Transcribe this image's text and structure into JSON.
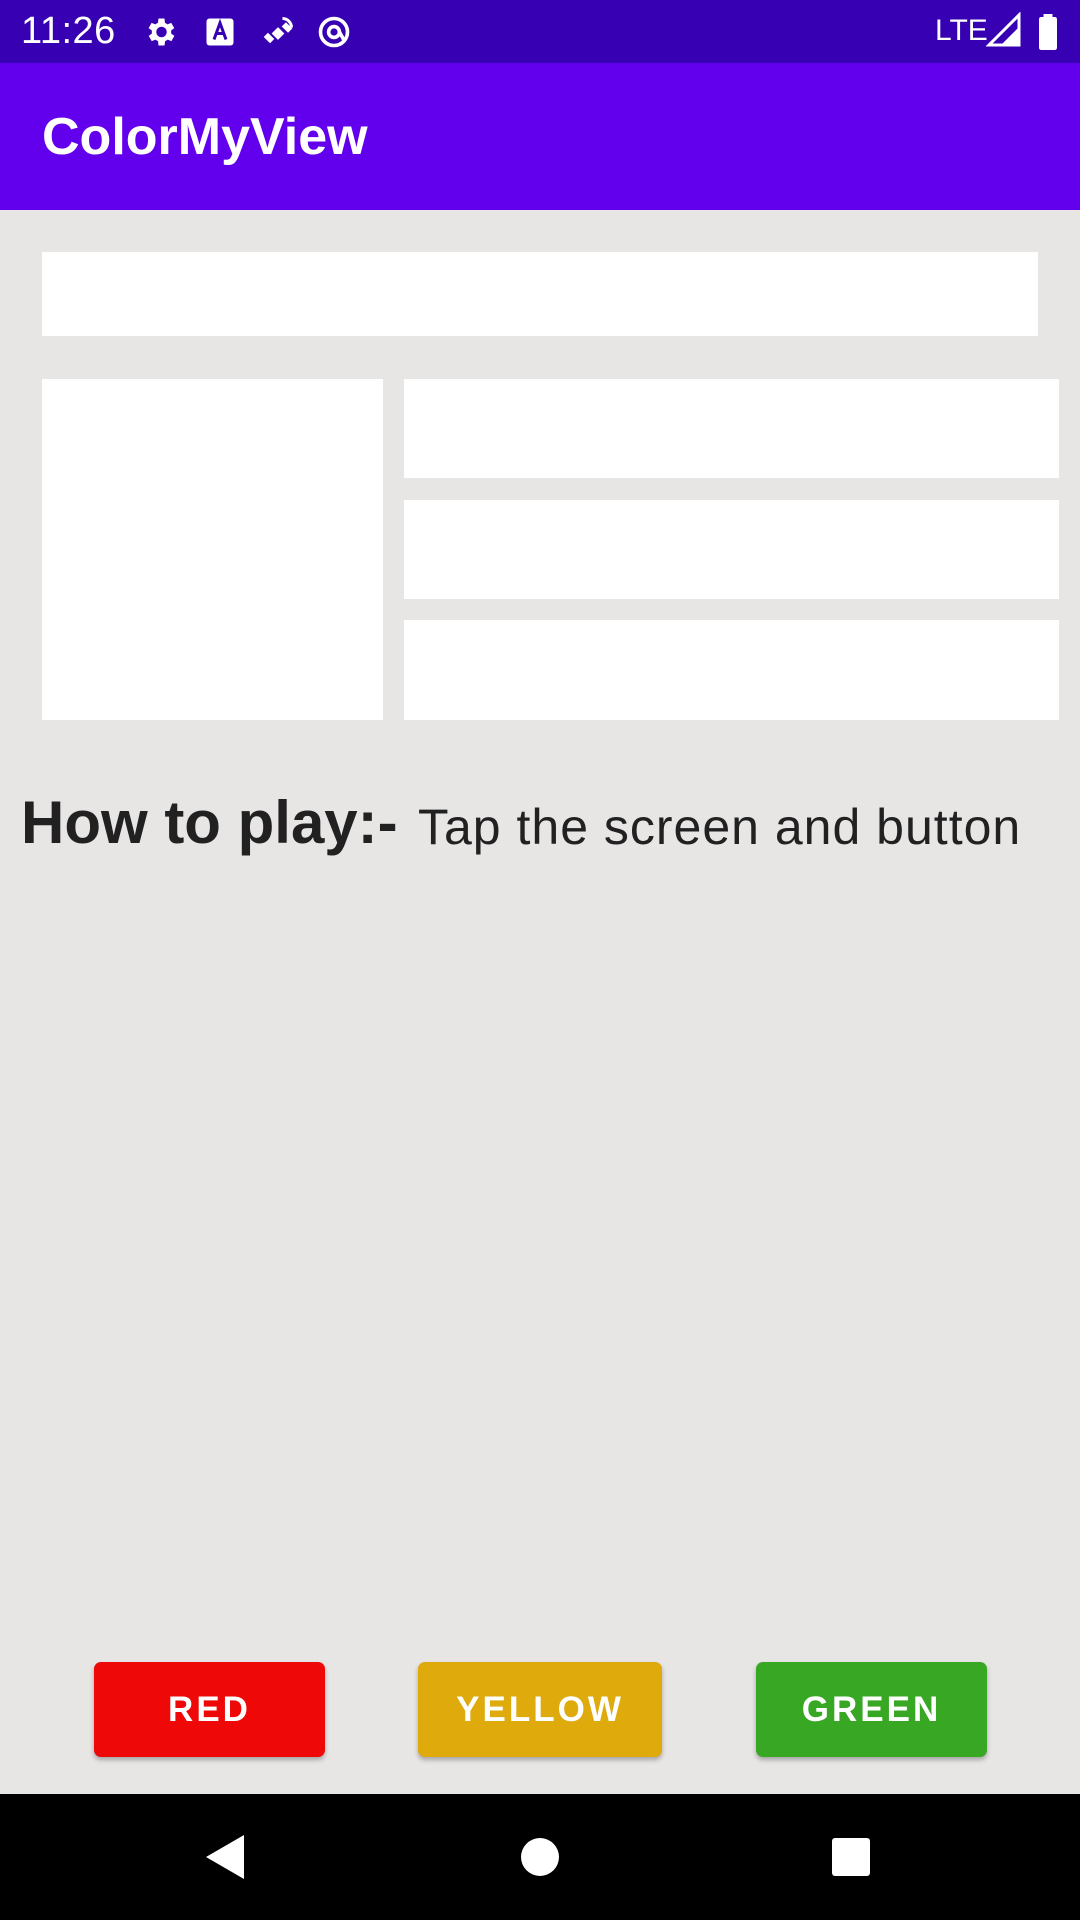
{
  "status_bar": {
    "time": "11:26",
    "network": "LTE",
    "icons": [
      "settings-icon",
      "text-a-icon",
      "satellite-icon",
      "at-sign-icon",
      "signal-icon",
      "battery-icon"
    ],
    "background": "#3700B3"
  },
  "app_bar": {
    "title": "ColorMyView",
    "background": "#6200EE"
  },
  "content": {
    "background": "#E8E5E5",
    "box_color": "#FFFFFF",
    "how_to_play_label": "How to play:-",
    "how_to_play_text": "Tap the screen and button"
  },
  "buttons": {
    "red": {
      "label": "RED",
      "color": "#EE0808"
    },
    "yellow": {
      "label": "YELLOW",
      "color": "#DEAA0C"
    },
    "green": {
      "label": "GREEN",
      "color": "#38A824"
    }
  },
  "nav_bar": {
    "icons": [
      "back-icon",
      "home-icon",
      "recents-icon"
    ]
  }
}
